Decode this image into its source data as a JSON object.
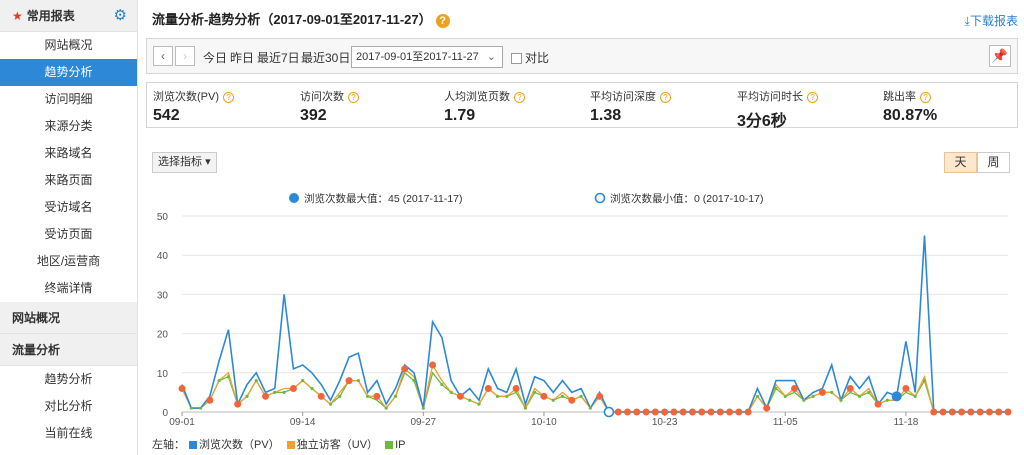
{
  "sidebar": {
    "group1": "常用报表",
    "group1_items": [
      "网站概况",
      "趋势分析",
      "访问明细",
      "来源分类",
      "来路域名",
      "来路页面",
      "受访域名",
      "受访页面",
      "地区/运营商",
      "终端详情"
    ],
    "group1_active": 1,
    "group2": "网站概况",
    "group3": "流量分析",
    "group3_items": [
      "趋势分析",
      "对比分析",
      "当前在线"
    ]
  },
  "header": {
    "title": "流量分析-趋势分析（2017-09-01至2017-11-27）",
    "download": "下载报表"
  },
  "toolbar": {
    "today": "今日",
    "yesterday": "昨日",
    "last7": "最近7日",
    "last30": "最近30日",
    "date_range": "2017-09-01至2017-11-27",
    "compare": "对比"
  },
  "metrics": [
    {
      "label": "浏览次数(PV)",
      "value": "542"
    },
    {
      "label": "访问次数",
      "value": "392"
    },
    {
      "label": "人均浏览页数",
      "value": "1.79"
    },
    {
      "label": "平均访问深度",
      "value": "1.38"
    },
    {
      "label": "平均访问时长",
      "value": "3分6秒"
    },
    {
      "label": "跳出率",
      "value": "80.87%"
    }
  ],
  "controls": {
    "select_metric": "选择指标",
    "day": "天",
    "week": "周"
  },
  "chart_data": {
    "type": "line",
    "annotation_max": "浏览次数最大值：45 (2017-11-17)",
    "annotation_min": "浏览次数最小值：0 (2017-10-17)",
    "max_index": 77,
    "min_index": 46,
    "ylim": [
      0,
      50
    ],
    "yticks": [
      0,
      10,
      20,
      30,
      40,
      50
    ],
    "xtick_labels": [
      "09-01",
      "09-14",
      "09-27",
      "10-10",
      "10-23",
      "11-05",
      "11-18"
    ],
    "xtick_indices": [
      0,
      13,
      26,
      39,
      52,
      65,
      78
    ],
    "colors": {
      "pv": "#2d89d8",
      "uv": "#f0a030",
      "ip": "#6cbb3c",
      "marker": "#f0653a"
    },
    "axis_label": "左轴：",
    "series": [
      {
        "name": "浏览次数（PV）",
        "key": "pv",
        "values": [
          7,
          1,
          1,
          4,
          13,
          21,
          2,
          7,
          10,
          5,
          6,
          30,
          11,
          12,
          10,
          7,
          3,
          8,
          14,
          15,
          5,
          8,
          2,
          6,
          12,
          10,
          1,
          23,
          19,
          8,
          4,
          6,
          3,
          11,
          6,
          5,
          11,
          2,
          9,
          8,
          5,
          8,
          5,
          6,
          1,
          5,
          0,
          0,
          0,
          0,
          0,
          0,
          0,
          0,
          0,
          0,
          0,
          0,
          0,
          0,
          0,
          0,
          6,
          1,
          8,
          8,
          8,
          3,
          5,
          6,
          12,
          3,
          9,
          6,
          9,
          2,
          5,
          4,
          18,
          5,
          45,
          0,
          0,
          0,
          0,
          0,
          0,
          0,
          0,
          0
        ]
      },
      {
        "name": "独立访客（UV）",
        "key": "uv",
        "values": [
          6,
          1,
          1,
          3,
          8,
          10,
          2,
          4,
          8,
          4,
          5,
          6,
          6,
          8,
          6,
          4,
          2,
          5,
          8,
          8,
          4,
          4,
          1,
          4,
          11,
          9,
          1,
          12,
          8,
          5,
          4,
          3,
          2,
          6,
          4,
          4,
          6,
          1,
          6,
          4,
          3,
          5,
          3,
          4,
          1,
          4,
          0,
          0,
          0,
          0,
          0,
          0,
          0,
          0,
          0,
          0,
          0,
          0,
          0,
          0,
          0,
          0,
          4,
          1,
          7,
          4,
          6,
          3,
          4,
          5,
          5,
          3,
          6,
          4,
          6,
          2,
          3,
          3,
          6,
          4,
          9,
          0,
          0,
          0,
          0,
          0,
          0,
          0,
          0,
          0
        ]
      },
      {
        "name": "IP",
        "key": "ip",
        "values": [
          6,
          1,
          1,
          3,
          8,
          9,
          2,
          4,
          8,
          4,
          5,
          5,
          6,
          8,
          6,
          4,
          2,
          4,
          8,
          8,
          4,
          3,
          1,
          4,
          10,
          8,
          1,
          10,
          7,
          5,
          4,
          3,
          2,
          6,
          4,
          4,
          5,
          1,
          5,
          4,
          3,
          4,
          3,
          4,
          1,
          4,
          0,
          0,
          0,
          0,
          0,
          0,
          0,
          0,
          0,
          0,
          0,
          0,
          0,
          0,
          0,
          0,
          4,
          1,
          6,
          4,
          5,
          3,
          4,
          5,
          5,
          3,
          5,
          4,
          5,
          2,
          3,
          3,
          5,
          4,
          8,
          0,
          0,
          0,
          0,
          0,
          0,
          0,
          0,
          0
        ]
      }
    ]
  }
}
